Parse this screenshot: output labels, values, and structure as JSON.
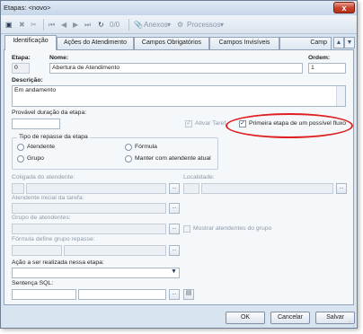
{
  "window": {
    "title": "Etapas: <novo>",
    "close_label": "x"
  },
  "toolbar": {
    "record_counter": "0/0",
    "anexos_label": "Anexos",
    "processos_label": "Processos"
  },
  "tabs": [
    {
      "label": "Identificação"
    },
    {
      "label": "Ações do Atendimento"
    },
    {
      "label": "Campos Obrigatórios"
    },
    {
      "label": "Campos Invisíveis"
    },
    {
      "label": "Camp"
    }
  ],
  "form": {
    "etapa_label": "Etapa:",
    "etapa_value": "0",
    "nome_label": "Nome:",
    "nome_value": "Abertura de Atendimento",
    "ordem_label": "Ordem:",
    "ordem_value": "1",
    "descricao_label": "Descrição:",
    "descricao_value": "Em andamento",
    "duracao_label": "Provável duração da etapa:",
    "ativar_tarefa_label": "Ativar Taref",
    "ativar_tarefa_checked": "✓",
    "primeira_etapa_label": "Primeira etapa de um possível fluxo",
    "primeira_etapa_checked": "✓",
    "repasse_group_label": "Tipo de repasse da etapa",
    "repasse_options": [
      "Atendente",
      "Fórmula",
      "Grupo",
      "Manter com atendente atual"
    ],
    "coligada_label": "Coligada do atendente:",
    "localidade_label": "Localidade:",
    "atendente_inicial_label": "Atendente inicial da tarefa:",
    "grupo_atendentes_label": "Grupo de atendentes:",
    "mostrar_atendentes_label": "Mostrar atendentes do grupo",
    "formula_label": "Fórmula define grupo repasse:",
    "acao_label": "Ação a ser realizada nessa etapa:",
    "sentenca_label": "Sentença SQL:",
    "browse_label": "..."
  },
  "buttons": {
    "ok": "OK",
    "cancelar": "Cancelar",
    "salvar": "Salvar"
  },
  "colors": {
    "highlight_ring": "#e02020",
    "window_bg": "#d9e4f1"
  }
}
